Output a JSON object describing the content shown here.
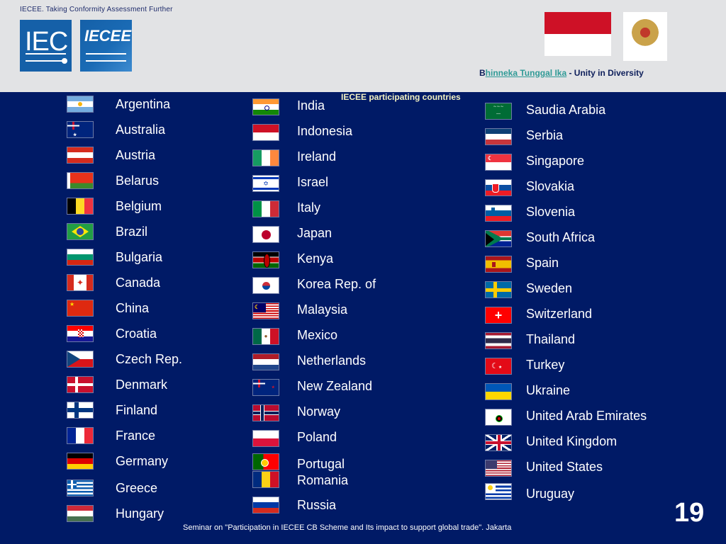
{
  "header": {
    "tagline": "IECEE. Taking Conformity Assessment Further",
    "logos": [
      {
        "name": "iec-logo",
        "text": "IEC"
      },
      {
        "name": "iecee-logo",
        "text": "IECEE"
      }
    ],
    "motto_prefix": "B",
    "motto_link": "hinneka Tunggal Ika",
    "motto_suffix": " - Unity in Diversity",
    "indonesia_flag_colors": [
      "#ce1126",
      "#ffffff"
    ]
  },
  "section_title": "IECEE participating countries",
  "columns": [
    {
      "countries": [
        {
          "name": "Argentina",
          "flag": "argentina"
        },
        {
          "name": "Australia",
          "flag": "australia"
        },
        {
          "name": "Austria",
          "flag": "austria"
        },
        {
          "name": "Belarus",
          "flag": "belarus"
        },
        {
          "name": "Belgium",
          "flag": "belgium"
        },
        {
          "name": "Brazil",
          "flag": "brazil"
        },
        {
          "name": "Bulgaria",
          "flag": "bulgaria"
        },
        {
          "name": "Canada",
          "flag": "canada"
        },
        {
          "name": "China",
          "flag": "china"
        },
        {
          "name": "Croatia",
          "flag": "croatia"
        },
        {
          "name": "Czech Rep.",
          "flag": "czech"
        },
        {
          "name": "Denmark",
          "flag": "denmark"
        },
        {
          "name": "Finland",
          "flag": "finland"
        },
        {
          "name": "France",
          "flag": "france"
        },
        {
          "name": "Germany",
          "flag": "germany"
        },
        {
          "name": "Greece",
          "flag": "greece"
        },
        {
          "name": "Hungary",
          "flag": "hungary"
        }
      ]
    },
    {
      "countries": [
        {
          "name": "India",
          "flag": "india"
        },
        {
          "name": "Indonesia",
          "flag": "indonesia"
        },
        {
          "name": "Ireland",
          "flag": "ireland"
        },
        {
          "name": "Israel",
          "flag": "israel"
        },
        {
          "name": "Italy",
          "flag": "italy"
        },
        {
          "name": "Japan",
          "flag": "japan"
        },
        {
          "name": "Kenya",
          "flag": "kenya"
        },
        {
          "name": "Korea Rep. of",
          "flag": "korea"
        },
        {
          "name": "Malaysia",
          "flag": "malaysia"
        },
        {
          "name": "Mexico",
          "flag": "mexico"
        },
        {
          "name": "Netherlands",
          "flag": "netherlands"
        },
        {
          "name": "New Zealand",
          "flag": "newzealand"
        },
        {
          "name": "Norway",
          "flag": "norway"
        },
        {
          "name": "Poland",
          "flag": "poland"
        },
        {
          "name": "Portugal",
          "flag": "portugal"
        },
        {
          "name": "Romania",
          "flag": "romania"
        },
        {
          "name": "Russia",
          "flag": "russia"
        }
      ]
    },
    {
      "countries": [
        {
          "name": "Saudia Arabia",
          "flag": "saudi"
        },
        {
          "name": "Serbia",
          "flag": "serbia"
        },
        {
          "name": "Singapore",
          "flag": "singapore"
        },
        {
          "name": "Slovakia",
          "flag": "slovakia"
        },
        {
          "name": "Slovenia",
          "flag": "slovenia"
        },
        {
          "name": "South Africa",
          "flag": "southafrica"
        },
        {
          "name": "Spain",
          "flag": "spain"
        },
        {
          "name": "Sweden",
          "flag": "sweden"
        },
        {
          "name": "Switzerland",
          "flag": "switzerland"
        },
        {
          "name": "Thailand",
          "flag": "thailand"
        },
        {
          "name": "Turkey",
          "flag": "turkey"
        },
        {
          "name": "Ukraine",
          "flag": "ukraine"
        },
        {
          "name": "United Arab Emirates",
          "flag": "uae"
        },
        {
          "name": "United Kingdom",
          "flag": "uk"
        },
        {
          "name": "United States",
          "flag": "usa"
        },
        {
          "name": "Uruguay",
          "flag": "uruguay"
        }
      ]
    }
  ],
  "footer": {
    "text": "Seminar on \"Participation in IECEE CB Scheme and Its impact to support global trade\". Jakarta",
    "page_number": "19"
  }
}
